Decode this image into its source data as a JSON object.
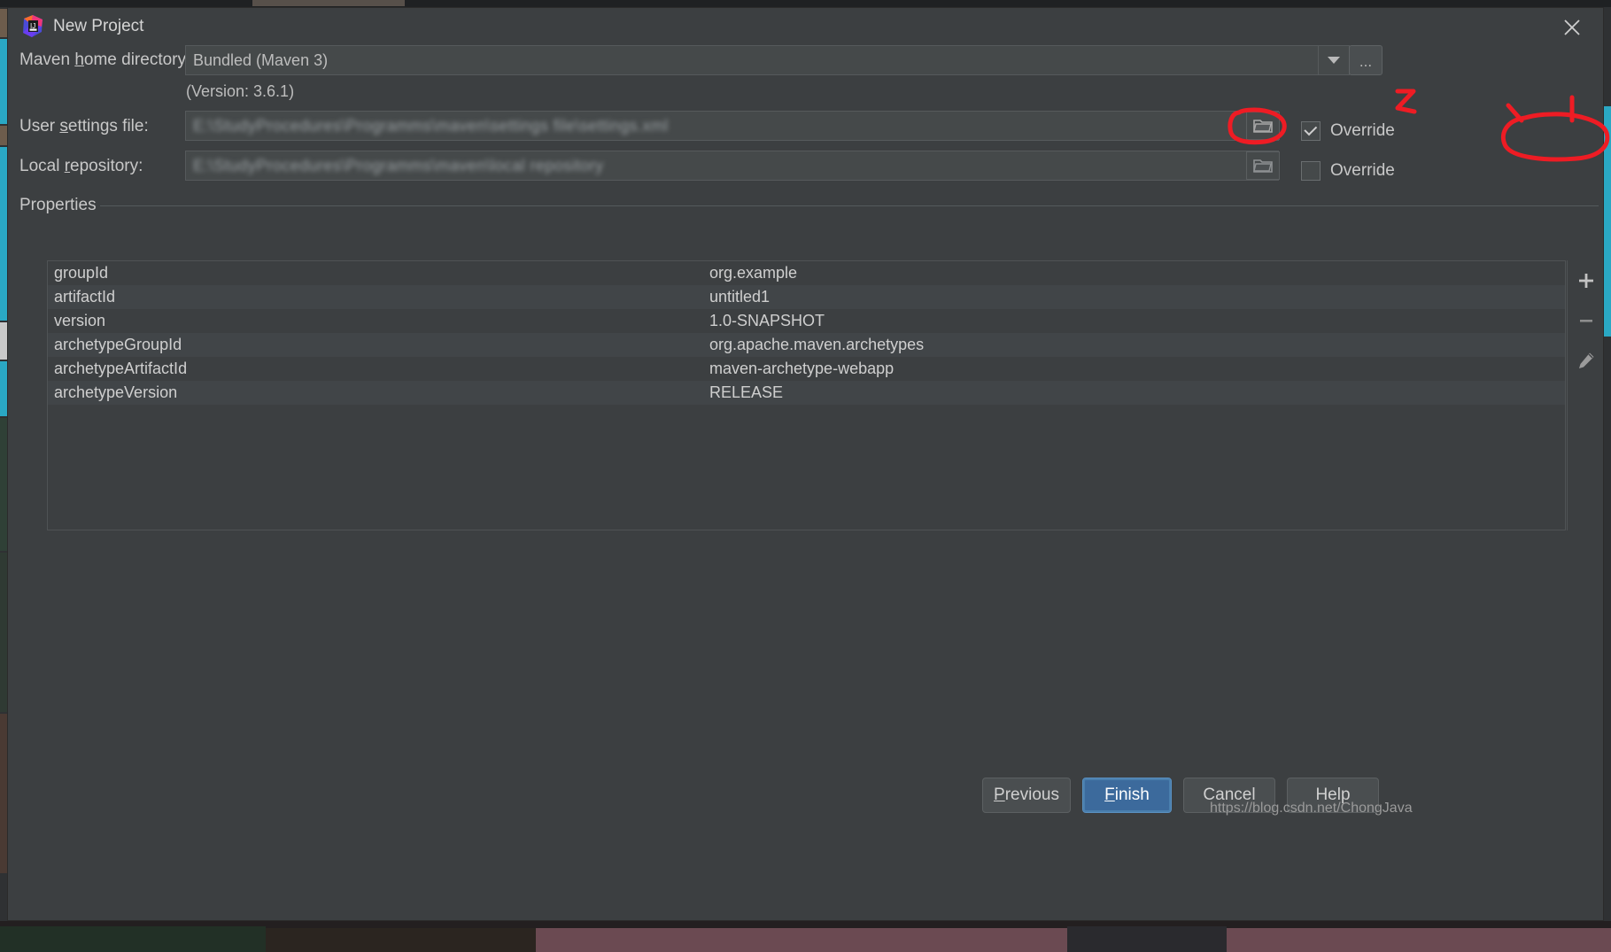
{
  "window": {
    "title": "New Project",
    "app_icon": "intellij-idea-logo",
    "close_icon": "close-icon"
  },
  "fields": {
    "maven_home": {
      "label_prefix": "Maven ",
      "label_mnemonic": "h",
      "label_suffix": "ome directory:",
      "label_full": "Maven home directory:",
      "value": "Bundled (Maven 3)",
      "dropdown_icon": "chevron-down-icon",
      "browse_label": "...",
      "version_note": "(Version: 3.6.1)"
    },
    "user_settings": {
      "label_prefix": "User ",
      "label_mnemonic": "s",
      "label_suffix": "ettings file:",
      "label_full": "User settings file:",
      "value": "E:\\StudyProcedures\\Programms\\maven\\settings file\\settings.xml",
      "folder_icon": "folder-icon",
      "override_label": "Override",
      "override_checked": true
    },
    "local_repository": {
      "label_prefix": "Local ",
      "label_mnemonic": "r",
      "label_suffix": "epository:",
      "label_full": "Local repository:",
      "value": "E:\\StudyProcedures\\Programms\\maven\\local repository",
      "folder_icon": "folder-icon",
      "override_label": "Override",
      "override_checked": false
    }
  },
  "properties": {
    "group_title": "Properties",
    "rows": [
      {
        "name": "groupId",
        "value": "org.example"
      },
      {
        "name": "artifactId",
        "value": "untitled1"
      },
      {
        "name": "version",
        "value": "1.0-SNAPSHOT"
      },
      {
        "name": "archetypeGroupId",
        "value": "org.apache.maven.archetypes"
      },
      {
        "name": "archetypeArtifactId",
        "value": "maven-archetype-webapp"
      },
      {
        "name": "archetypeVersion",
        "value": "RELEASE"
      }
    ],
    "toolbar": [
      {
        "icon": "plus-icon",
        "name": "add-property-button"
      },
      {
        "icon": "minus-icon",
        "name": "remove-property-button"
      },
      {
        "icon": "pencil-icon",
        "name": "edit-property-button"
      }
    ]
  },
  "footer": {
    "previous": {
      "prefix": "",
      "mnemonic": "P",
      "suffix": "revious",
      "full": "Previous"
    },
    "finish": {
      "prefix": "",
      "mnemonic": "F",
      "suffix": "inish",
      "full": "Finish"
    },
    "cancel": {
      "full": "Cancel"
    },
    "help": {
      "full": "Help"
    },
    "watermark": "https://blog.csdn.net/ChongJava"
  },
  "annotations": {
    "marker_2": "2",
    "accent_color": "#ee1c24"
  }
}
